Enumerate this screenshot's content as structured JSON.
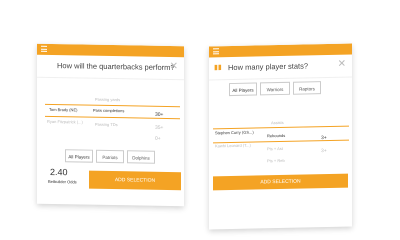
{
  "left_card": {
    "question": "How will the quarterbacks perform?",
    "column_header": "Passing yards",
    "rows": [
      {
        "player": "Tom Brady (NE)",
        "stat": "Pass completions",
        "value": "30+"
      },
      {
        "player": "Ryan Fitzpatrick (...)",
        "stat": "Passing TDs",
        "value": "35+"
      }
    ],
    "row3_value": "0+",
    "filters": [
      "All Players",
      "Patriots",
      "Dolphins"
    ],
    "odds_value": "2.40",
    "odds_label": "Betbuilder Odds",
    "button_label": "ADD SELECTION"
  },
  "right_card": {
    "question": "How many player stats?",
    "filters": [
      "All Players",
      "Warriors",
      "Raptors"
    ],
    "column_header": "Assists",
    "rows": [
      {
        "player": "Stephen Curry (GS...)",
        "stat": "Rebounds",
        "value": "3+"
      },
      {
        "player": "Kawhi Leonard (T...)",
        "stat": "Pts + Ast",
        "value": "3+"
      }
    ],
    "row3_stat": "Pts + Reb",
    "button_label": "ADD SELECTION"
  },
  "colors": {
    "accent": "#f4a324"
  }
}
